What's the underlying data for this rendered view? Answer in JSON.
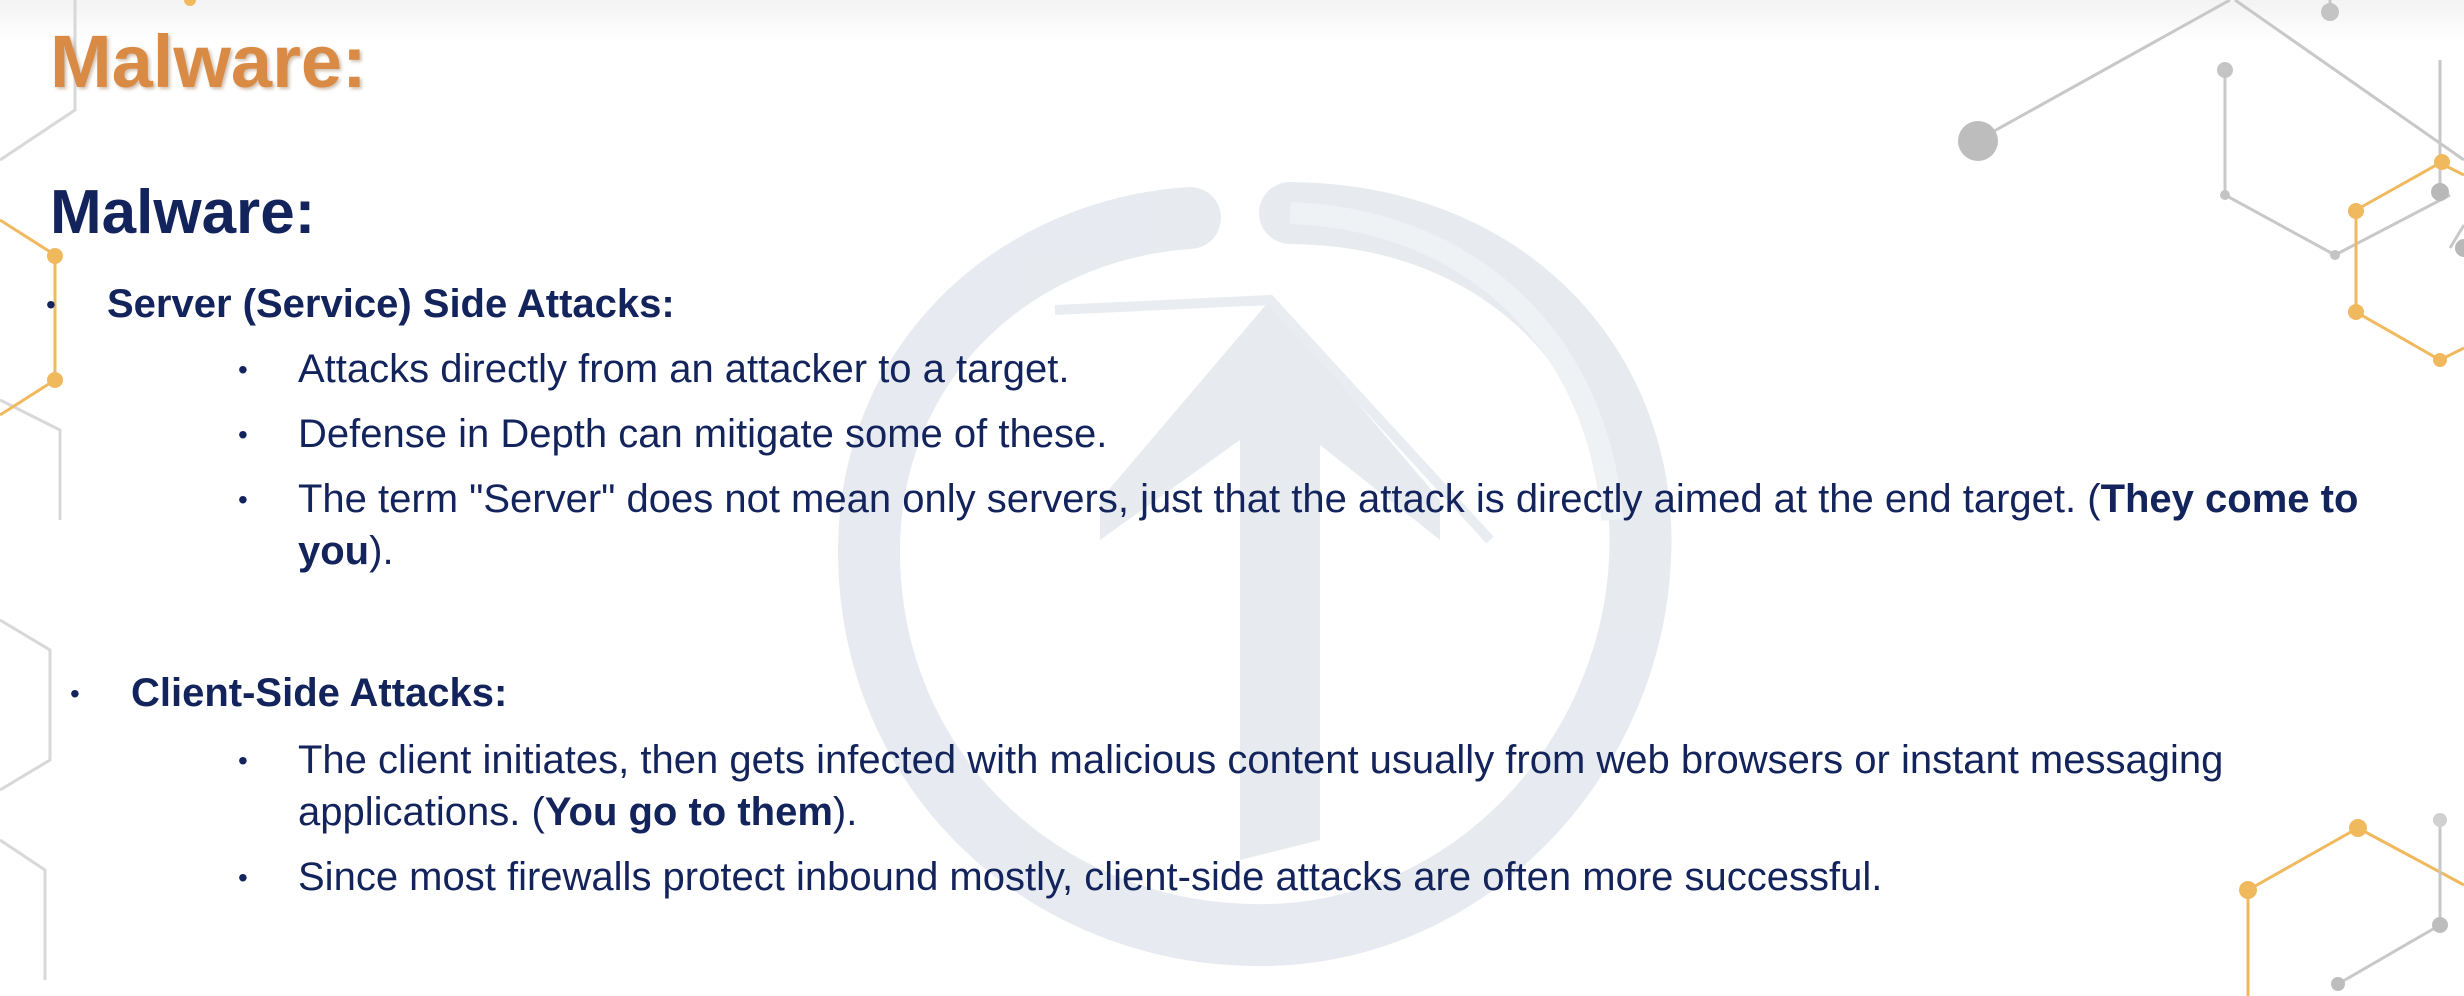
{
  "slide": {
    "title": "Malware:",
    "heading": "Malware:",
    "sections": [
      {
        "label": "Server (Service) Side Attacks:",
        "items": [
          {
            "text": "Attacks directly from an attacker to a target."
          },
          {
            "text": "Defense in Depth can mitigate some of these."
          },
          {
            "text_before": "The term \"Server\" does not mean only servers, just that the attack is directly aimed at the end target. (",
            "bold": "They come to you",
            "text_after": ")."
          }
        ]
      },
      {
        "label": "Client-Side Attacks:",
        "items": [
          {
            "text_before": "The client initiates, then gets infected with malicious content usually from web browsers or instant messaging applications. (",
            "bold": "You go to them",
            "text_after": ")."
          },
          {
            "text": "Since most firewalls protect inbound mostly, client-side attacks are often more successful."
          }
        ]
      }
    ],
    "bullet_glyph": "•",
    "colors": {
      "title": "#d98a45",
      "body_text": "#13235b",
      "watermark": "#dde3ea",
      "hex_orange": "#f0b95e",
      "hex_gray": "#c4c4c4"
    }
  }
}
